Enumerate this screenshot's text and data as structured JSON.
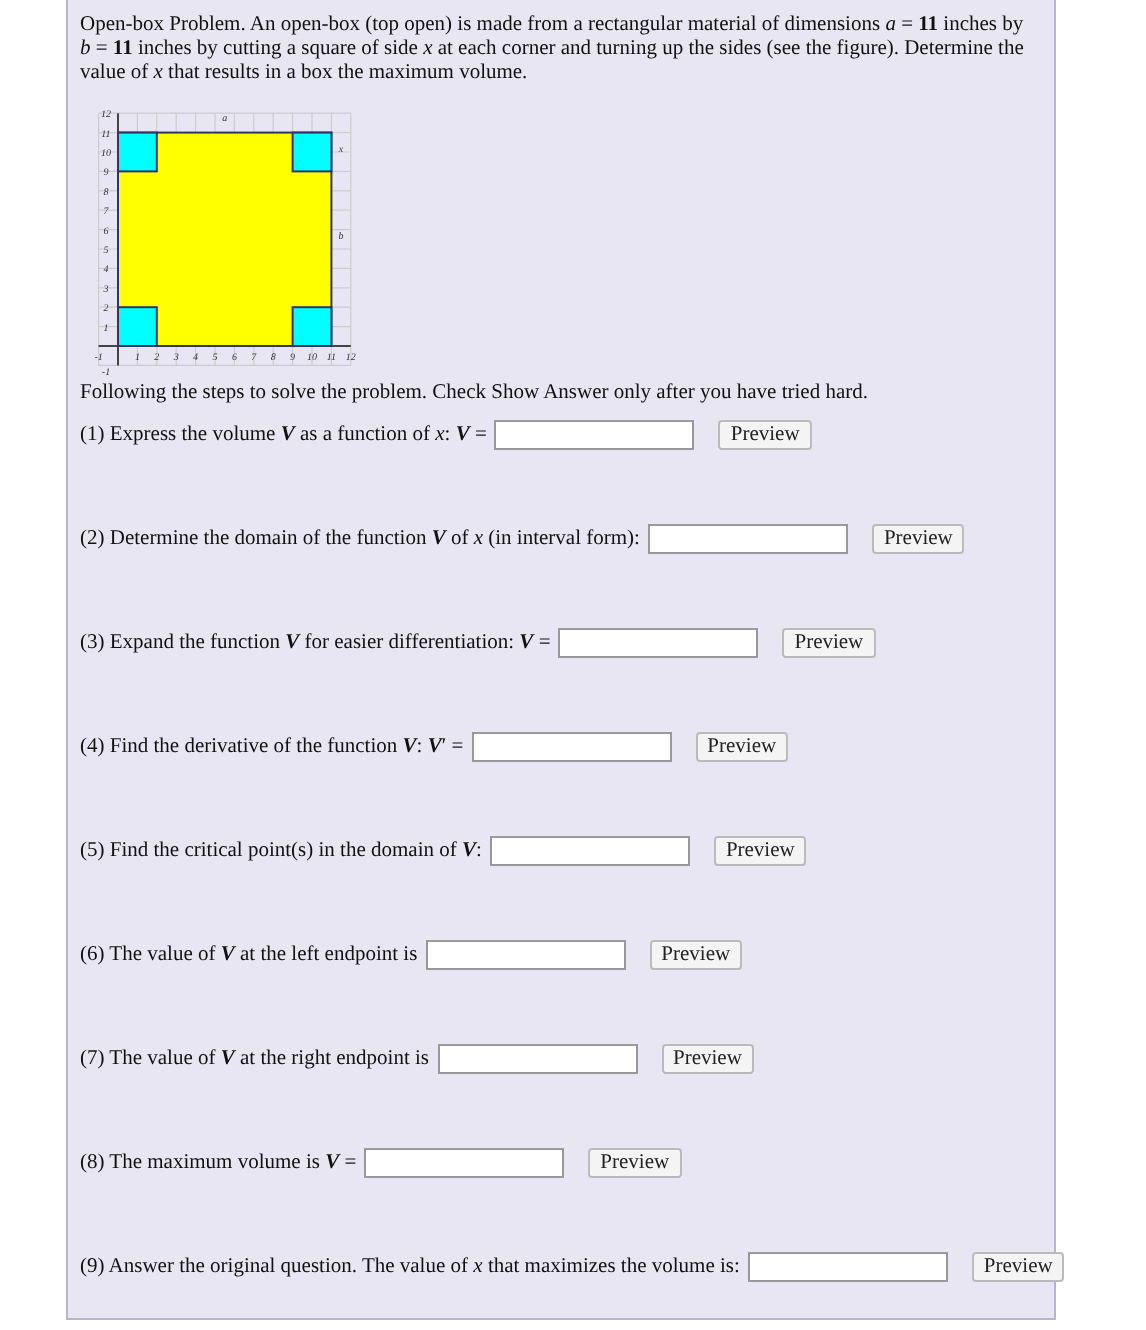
{
  "problem": "Open-box Problem. An open-box (top open) is made from a rectangular material of dimensions *a* = **11** inches by *b* = **11** inches by cutting a square of side *x* at each corner and turning up the sides (see the figure). Determine the value of *x* that results in a box the maximum volume.",
  "figure": {
    "kind": "picture",
    "x_ticks": [
      "-1",
      "1",
      "2",
      "3",
      "4",
      "5",
      "6",
      "7",
      "8",
      "9",
      "10",
      "11",
      "12"
    ],
    "y_ticks": [
      "12",
      "11",
      "10",
      "9",
      "8",
      "7",
      "6",
      "5",
      "4",
      "3",
      "2",
      "1",
      "-1"
    ],
    "side_a_label": "a",
    "side_b_label": "b",
    "cut_label": "x"
  },
  "instructions": "Following the steps to solve the problem. Check Show Answer only after you have tried hard.",
  "steps": [
    {
      "prompt": "(1) Express the volume **V** as a function of *x*: **V** =",
      "button": "Preview"
    },
    {
      "prompt": "(2) Determine the domain of the function **V** of *x* (in interval form):",
      "button": "Preview"
    },
    {
      "prompt": "(3) Expand the function **V** for easier differentiation: **V** =",
      "button": "Preview"
    },
    {
      "prompt": "(4) Find the derivative of the function **V**: **V**′ =",
      "button": "Preview"
    },
    {
      "prompt": "(5) Find the critical point(s) in the domain of **V**:",
      "button": "Preview"
    },
    {
      "prompt": "(6) The value of **V** at the left endpoint is",
      "button": "Preview"
    },
    {
      "prompt": "(7) The value of **V** at the right endpoint is",
      "button": "Preview"
    },
    {
      "prompt": "(8) The maximum volume is **V** =",
      "button": "Preview"
    },
    {
      "prompt": "(9) Answer the original question. The value of *x* that maximizes the volume is:",
      "button": "Preview"
    }
  ]
}
